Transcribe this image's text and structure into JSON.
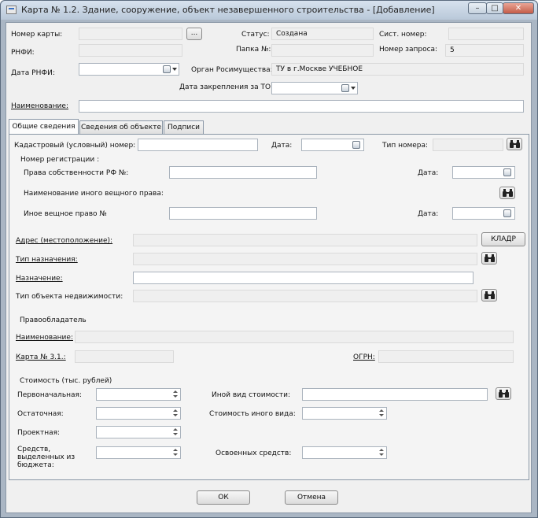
{
  "window": {
    "title": "Карта № 1.2. Здание, сооружение, объект незавершенного строительства - [Добавление]",
    "minimize": "–",
    "maximize": "□",
    "close": "✕"
  },
  "header": {
    "card_number_label": "Номер карты:",
    "browse_button": "...",
    "status_label": "Статус:",
    "status_value": "Создана",
    "system_number_label": "Сист. номер:",
    "rnfi_label": "РНФИ:",
    "folder_label": "Папка №:",
    "request_number_label": "Номер запроса:",
    "request_number_value": "5",
    "rnfi_date_label": "Дата РНФИ:",
    "agency_label": "Орган Росимущества:",
    "agency_value": "ТУ в г.Москве УЧЕБНОЕ",
    "assignment_date_label": "Дата закрепления за ТО:",
    "name_label": "Наименование:"
  },
  "tabs": [
    {
      "label": "Общие сведения",
      "active": true
    },
    {
      "label": "Сведения об объекте",
      "active": false
    },
    {
      "label": "Подписи",
      "active": false
    }
  ],
  "general": {
    "cadastral_label": "Кадастровый (условный) номер:",
    "date_label": "Дата:",
    "number_type_label": "Тип номера:",
    "registration_group": "Номер регистрации :",
    "rf_ownership_label": "Права собственности РФ №:",
    "rf_date_label": "Дата:",
    "other_right_name_label": "Наименование иного вещного права:",
    "other_right_label": "Иное вещное право  №",
    "other_date_label": "Дата:",
    "address_label": "Адрес (местоположение):",
    "kladr_button": "КЛАДР",
    "purpose_type_label": "Тип назначения:",
    "purpose_label": "Назначение:",
    "property_type_label": "Тип объекта недвижимости:",
    "owner_group": "Правообладатель",
    "owner_name_label": "Наименование:",
    "card_31_label": "Карта № 3.1.:",
    "ogrn_label": "ОГРН:",
    "cost_group": "Стоимость (тыс. рублей)",
    "initial_label": "Первоначальная:",
    "residual_label": "Остаточная:",
    "project_label": "Проектная:",
    "budget_label_1": "Средств,",
    "budget_label_2": "выделенных из",
    "budget_label_3": "бюджета:",
    "other_cost_kind_label": "Иной вид стоимости:",
    "other_cost_label": "Стоимость иного вида:",
    "spent_label": "Освоенных средств:"
  },
  "footer": {
    "ok_button": "ОК",
    "cancel_button": "Отмена"
  },
  "icons": {
    "binoculars": "binoculars-icon",
    "calendar": "calendar-icon"
  }
}
